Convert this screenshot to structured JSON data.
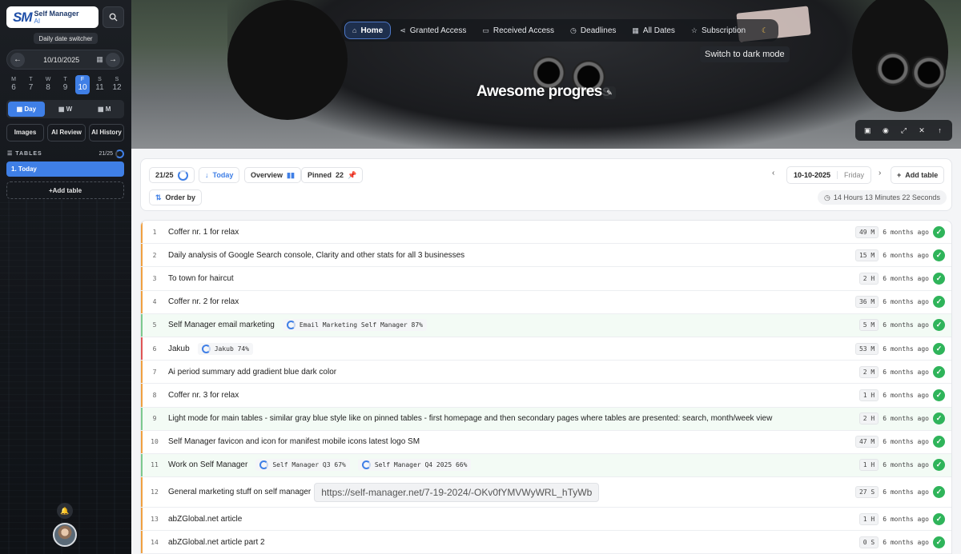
{
  "sidebar": {
    "logo_mark": "SM",
    "logo_line1": "Self Manager",
    "logo_line2": "AI",
    "tooltip": "Daily date switcher",
    "date": "10/10/2025",
    "week": [
      {
        "dl": "M",
        "dn": "6"
      },
      {
        "dl": "T",
        "dn": "7"
      },
      {
        "dl": "W",
        "dn": "8"
      },
      {
        "dl": "T",
        "dn": "9"
      },
      {
        "dl": "F",
        "dn": "10"
      },
      {
        "dl": "S",
        "dn": "11"
      },
      {
        "dl": "S",
        "dn": "12"
      }
    ],
    "views": {
      "day": "Day",
      "week": "W",
      "month": "M"
    },
    "buttons": {
      "images": "Images",
      "review": "AI Review",
      "history": "AI History"
    },
    "tables_label": "TABLES",
    "tables_count": "21/25",
    "table_item": "1. Today",
    "add_table": "+Add table"
  },
  "nav": {
    "home": "Home",
    "granted": "Granted Access",
    "received": "Received Access",
    "deadlines": "Deadlines",
    "dates": "All Dates",
    "subscription": "Subscription",
    "dark_tip": "Switch to dark mode"
  },
  "hero": {
    "title": "Awesome progress"
  },
  "toolbar": {
    "count": "21/25",
    "today": "Today",
    "overview": "Overview",
    "pinned": "Pinned",
    "pinned_count": "22",
    "order_by": "Order by",
    "date": "10-10-2025",
    "weekday": "Friday",
    "add_table": "Add table",
    "timer": "14 Hours 13 Minutes 22 Seconds"
  },
  "colors": {
    "accent": "#3f7fe6",
    "success": "#2fb45a",
    "orange": "#f0a040",
    "green": "#7cc98e",
    "red": "#e05555"
  },
  "tasks": [
    {
      "n": "1",
      "text": "Coffer nr. 1 for relax",
      "dur": "49 M",
      "ago": "6 months ago"
    },
    {
      "n": "2",
      "text": "Daily analysis of Google Search console, Clarity and other stats for all 3 businesses",
      "dur": "15 M",
      "ago": "6 months ago"
    },
    {
      "n": "3",
      "text": "To town for haircut",
      "dur": "2 H",
      "ago": "6 months ago"
    },
    {
      "n": "4",
      "text": "Coffer nr. 2 for relax",
      "dur": "36 M",
      "ago": "6 months ago"
    },
    {
      "n": "5",
      "text": "Self Manager email marketing",
      "tag": "Email Marketing Self Manager 87%",
      "dur": "5 M",
      "ago": "6 months ago"
    },
    {
      "n": "6",
      "text": "Jakub",
      "tag": "Jakub 74%",
      "dur": "53 M",
      "ago": "6 months ago"
    },
    {
      "n": "7",
      "text": "Ai period summary add gradient blue dark color",
      "dur": "2 M",
      "ago": "6 months ago"
    },
    {
      "n": "8",
      "text": "Coffer nr. 3 for relax",
      "dur": "1 H",
      "ago": "6 months ago"
    },
    {
      "n": "9",
      "text": "Light mode for main tables - similar gray blue style like on pinned tables - first homepage and then secondary pages where tables are presented: search, month/week view",
      "dur": "2 H",
      "ago": "6 months ago"
    },
    {
      "n": "10",
      "text": "Self Manager favicon and icon for manifest mobile icons latest logo SM",
      "dur": "47 M",
      "ago": "6 months ago"
    },
    {
      "n": "11",
      "text": "Work on Self Manager",
      "tag": "Self Manager Q3 67%",
      "tag2": "Self Manager Q4 2025 66%",
      "dur": "1 H",
      "ago": "6 months ago"
    },
    {
      "n": "12",
      "text": "General marketing stuff on self manager",
      "url": "https://self-manager.net/7-19-2024/-OKv0fYMVWyWRL_hTyWb",
      "dur": "27 S",
      "ago": "6 months ago"
    },
    {
      "n": "13",
      "text": "abZGlobal.net article",
      "dur": "1 H",
      "ago": "6 months ago"
    },
    {
      "n": "14",
      "text": "abZGlobal.net article part 2",
      "dur": "0 S",
      "ago": "6 months ago"
    }
  ]
}
